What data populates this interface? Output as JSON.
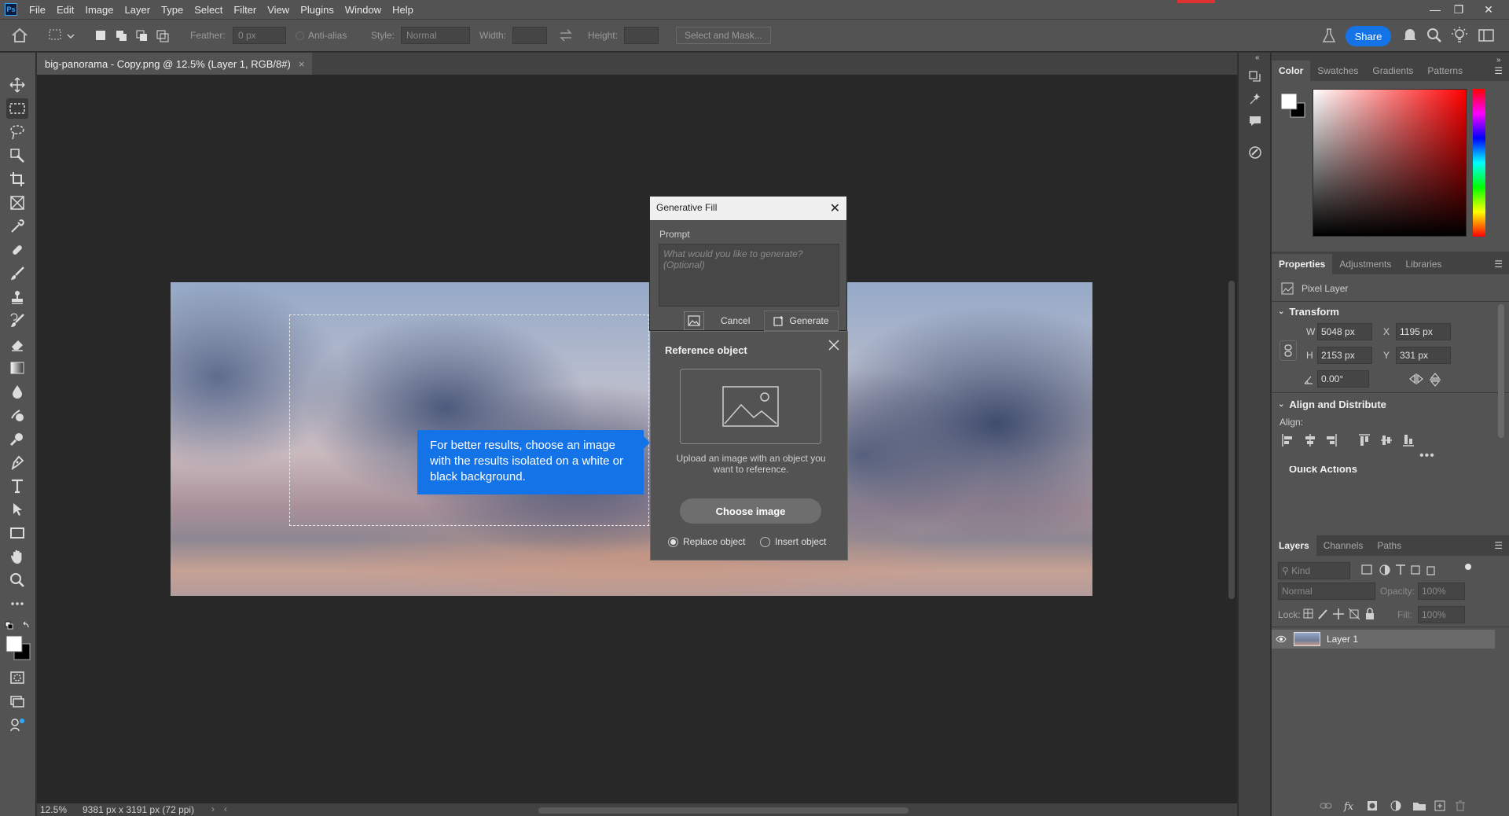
{
  "menubar": {
    "logo": "Ps",
    "items": [
      "File",
      "Edit",
      "Image",
      "Layer",
      "Type",
      "Select",
      "Filter",
      "View",
      "Plugins",
      "Window",
      "Help"
    ],
    "window_controls": [
      "—",
      "❐",
      "✕"
    ]
  },
  "options": {
    "feather_label": "Feather:",
    "feather_value": "0 px",
    "antialias_label": "Anti-alias",
    "style_label": "Style:",
    "style_value": "Normal",
    "width_label": "Width:",
    "height_label": "Height:",
    "select_mask": "Select and Mask...",
    "share": "Share"
  },
  "document": {
    "tab_title": "big-panorama - Copy.png @ 12.5% (Layer 1, RGB/8#)",
    "tab_close": "×",
    "zoom": "12.5%",
    "dimensions": "9381 px x 3191 px (72 ppi)",
    "status_arrow": "›",
    "scroll_left": "‹"
  },
  "tooltip": {
    "text": "For better results, choose an image with the results isolated on a white or black background."
  },
  "generative_fill": {
    "title": "Generative Fill",
    "prompt_label": "Prompt",
    "prompt_placeholder": "What would you like to generate? (Optional)",
    "cancel": "Cancel",
    "generate": "Generate"
  },
  "reference_object": {
    "title": "Reference object",
    "upload_text": "Upload an image with an object you want to reference.",
    "choose_image": "Choose image",
    "replace_object": "Replace object",
    "insert_object": "Insert object",
    "replace_selected": true
  },
  "color_panel": {
    "tabs": [
      "Color",
      "Swatches",
      "Gradients",
      "Patterns"
    ],
    "foreground": "#ffffff",
    "background": "#000000"
  },
  "properties_panel": {
    "tabs": [
      "Properties",
      "Adjustments",
      "Libraries"
    ],
    "layer_type": "Pixel Layer",
    "transform_title": "Transform",
    "w_label": "W",
    "w_value": "5048 px",
    "h_label": "H",
    "h_value": "2153 px",
    "x_label": "X",
    "x_value": "1195 px",
    "y_label": "Y",
    "y_value": "331 px",
    "angle_value": "0.00°",
    "align_title": "Align and Distribute",
    "align_label": "Align:",
    "quick_actions": "Quick Actions"
  },
  "layers_panel": {
    "tabs": [
      "Layers",
      "Channels",
      "Paths"
    ],
    "kind_placeholder": "Kind",
    "blend_mode": "Normal",
    "opacity_label": "Opacity:",
    "opacity_value": "100%",
    "lock_label": "Lock:",
    "fill_label": "Fill:",
    "fill_value": "100%",
    "layer_name": "Layer 1"
  }
}
